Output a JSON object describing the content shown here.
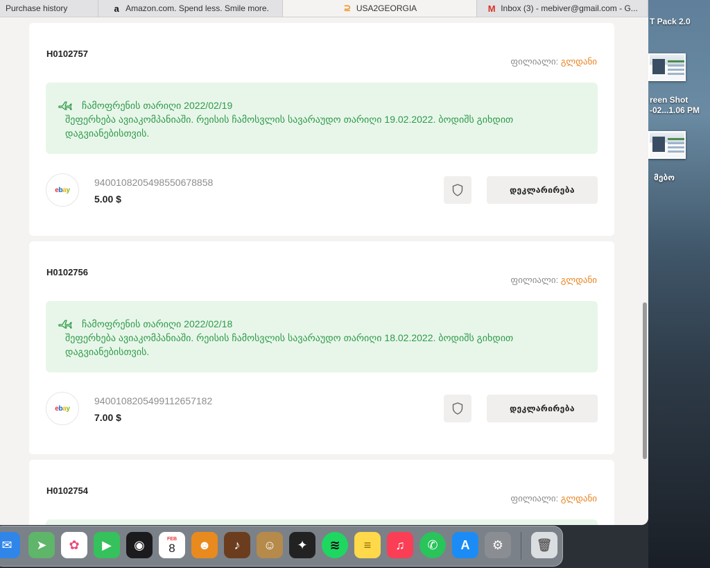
{
  "tabs": [
    {
      "label": "Purchase history",
      "icon": "none",
      "active": false
    },
    {
      "label": "Amazon.com. Spend less. Smile more.",
      "icon": "amazon-icon",
      "active": false
    },
    {
      "label": "USA2GEORGIA",
      "icon": "usa2georgia-icon",
      "active": true
    },
    {
      "label": "Inbox (3) - mebiver@gmail.com - G...",
      "icon": "gmail-icon",
      "active": false
    }
  ],
  "desktop": {
    "partial_label": "T Pack 2.0",
    "screenshot_line1": "reen Shot",
    "screenshot_line2": "-02...1.06 PM",
    "folder_label": "მებო"
  },
  "branch_label": "ფილიალი:",
  "branch_city": "გლდანი",
  "declare_label": "დეკლარირება",
  "orders": [
    {
      "id": "H0102757",
      "arrival": "ჩამოფრენის თარიღი 2022/02/19",
      "message": "შეფერხება ავიაკომპანიაში. რეისის ჩამოსვლის სავარაუდო თარიღი 19.02.2022. ბოდიშს გიხდით დაგვიანებისთვის.",
      "tracking": "9400108205498550678858",
      "price": "5.00 $"
    },
    {
      "id": "H0102756",
      "arrival": "ჩამოფრენის თარიღი 2022/02/18",
      "message": "შეფერხება ავიაკომპანიაში. რეისის ჩამოსვლის სავარაუდო თარიღი 18.02.2022. ბოდიშს გიხდით დაგვიანებისთვის.",
      "tracking": "9400108205499112657182",
      "price": "7.00 $"
    },
    {
      "id": "H0102754"
    }
  ],
  "store_logo": {
    "e": "e",
    "b": "b",
    "a": "a",
    "y": "y"
  },
  "dock": {
    "calendar_month": "FEB",
    "calendar_day": "8",
    "apps": [
      "mail-icon",
      "maps-icon",
      "photos-icon",
      "facetime-icon",
      "music-utility-icon",
      "calendar-icon",
      "photo-booth-icon",
      "garageband-icon",
      "contacts-icon",
      "final-cut-icon",
      "spotify-icon",
      "notes-icon",
      "music-icon",
      "whatsapp-icon",
      "app-store-icon",
      "system-preferences-icon",
      "trash-icon"
    ]
  },
  "colors": {
    "accent_orange": "#e8821e",
    "notice_green": "#2e9a48",
    "notice_bg": "#e8f6ea"
  }
}
